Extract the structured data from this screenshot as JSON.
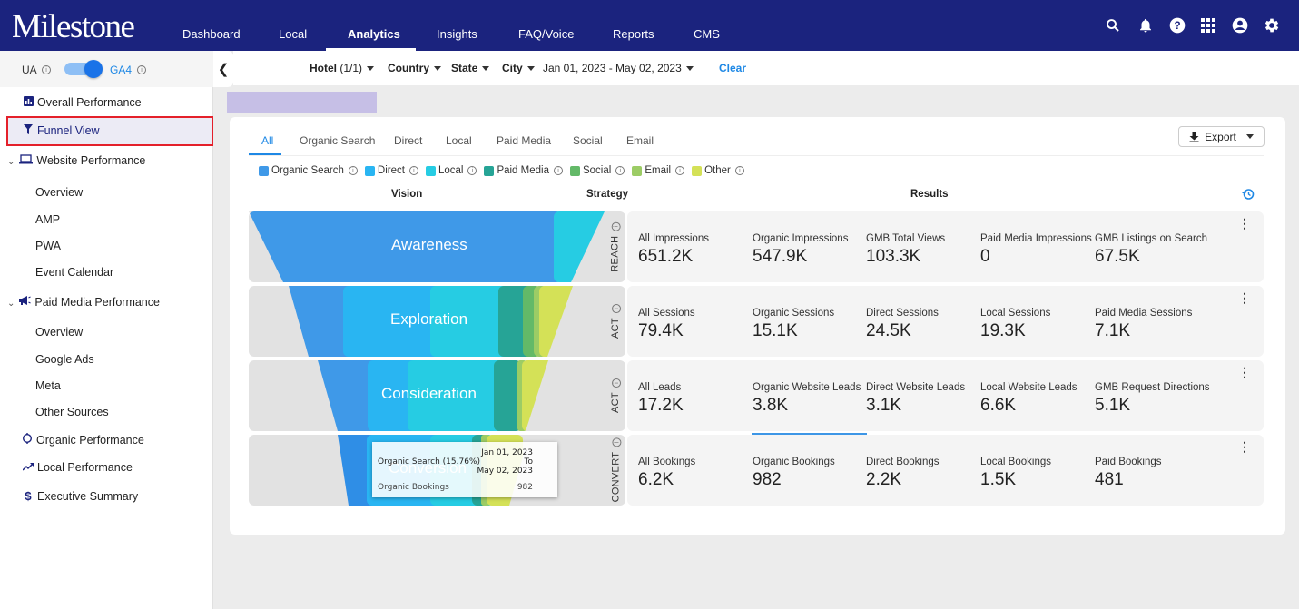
{
  "header": {
    "logo": "Milestone",
    "nav": [
      "Dashboard",
      "Local",
      "Analytics",
      "Insights",
      "FAQ/Voice",
      "Reports",
      "CMS"
    ],
    "active_nav": "Analytics",
    "icons": [
      "search-icon",
      "bell-icon",
      "help-icon",
      "apps-grid-icon",
      "account-icon",
      "settings-icon"
    ]
  },
  "sidebar": {
    "toggle": {
      "left_label": "UA",
      "right_label": "GA4",
      "selected": "GA4"
    },
    "items": [
      {
        "label": "Overall Performance",
        "icon": "bar-chart-icon"
      },
      {
        "label": "Funnel View",
        "icon": "funnel-icon",
        "active": true
      },
      {
        "label": "Website Performance",
        "icon": "laptop-icon",
        "expanded": true
      },
      {
        "label": "Overview"
      },
      {
        "label": "AMP"
      },
      {
        "label": "PWA"
      },
      {
        "label": "Event Calendar"
      },
      {
        "label": "Paid Media Performance",
        "icon": "megaphone-icon",
        "expanded": true
      },
      {
        "label": "Overview"
      },
      {
        "label": "Google Ads"
      },
      {
        "label": "Meta"
      },
      {
        "label": "Other Sources"
      },
      {
        "label": "Organic Performance",
        "icon": "organic-icon"
      },
      {
        "label": "Local Performance",
        "icon": "trend-icon"
      },
      {
        "label": "Executive Summary",
        "icon": "dollar-icon"
      }
    ]
  },
  "filters": {
    "hotel_label": "Hotel",
    "hotel_count": "(1/1)",
    "country": "Country",
    "state": "State",
    "city": "City",
    "date_range": "Jan 01, 2023 - May 02, 2023",
    "clear": "Clear"
  },
  "tabs": [
    "All",
    "Organic Search",
    "Direct",
    "Local",
    "Paid Media",
    "Social",
    "Email"
  ],
  "active_tab": "All",
  "export_label": "Export",
  "legend": [
    {
      "label": "Organic Search",
      "color": "#3f99e8"
    },
    {
      "label": "Direct",
      "color": "#29b5f2"
    },
    {
      "label": "Local",
      "color": "#26cce3"
    },
    {
      "label": "Paid Media",
      "color": "#26a496"
    },
    {
      "label": "Social",
      "color": "#63b968"
    },
    {
      "label": "Email",
      "color": "#9ccc65"
    },
    {
      "label": "Other",
      "color": "#d4e157"
    }
  ],
  "columns": {
    "vision": "Vision",
    "strategy": "Strategy",
    "results": "Results"
  },
  "stages": [
    {
      "name": "Awareness",
      "strategy": "REACH",
      "metrics": [
        {
          "label": "All Impressions",
          "value": "651.2K"
        },
        {
          "label": "Organic Impressions",
          "value": "547.9K"
        },
        {
          "label": "GMB Total Views",
          "value": "103.3K"
        },
        {
          "label": "Paid Media Impressions",
          "value": "0"
        },
        {
          "label": "GMB Listings on Search",
          "value": "67.5K"
        }
      ]
    },
    {
      "name": "Exploration",
      "strategy": "ACT",
      "metrics": [
        {
          "label": "All Sessions",
          "value": "79.4K"
        },
        {
          "label": "Organic Sessions",
          "value": "15.1K"
        },
        {
          "label": "Direct Sessions",
          "value": "24.5K"
        },
        {
          "label": "Local Sessions",
          "value": "19.3K"
        },
        {
          "label": "Paid Media Sessions",
          "value": "7.1K"
        }
      ]
    },
    {
      "name": "Consideration",
      "strategy": "ACT",
      "metrics": [
        {
          "label": "All Leads",
          "value": "17.2K"
        },
        {
          "label": "Organic Website Leads",
          "value": "3.8K"
        },
        {
          "label": "Direct Website Leads",
          "value": "3.1K"
        },
        {
          "label": "Local Website Leads",
          "value": "6.6K"
        },
        {
          "label": "GMB Request Directions",
          "value": "5.1K"
        }
      ]
    },
    {
      "name": "Conversion",
      "strategy": "CONVERT",
      "metrics": [
        {
          "label": "All Bookings",
          "value": "6.2K"
        },
        {
          "label": "Organic Bookings",
          "value": "982"
        },
        {
          "label": "Direct Bookings",
          "value": "2.2K"
        },
        {
          "label": "Local Bookings",
          "value": "1.5K"
        },
        {
          "label": "Paid Bookings",
          "value": "481"
        }
      ]
    }
  ],
  "tooltip": {
    "series": "Organic Search (15.76%)",
    "date_from": "Jan 01, 2023",
    "date_to_word": "To",
    "date_to": "May 02, 2023",
    "metric": "Organic Bookings",
    "value": "982"
  }
}
